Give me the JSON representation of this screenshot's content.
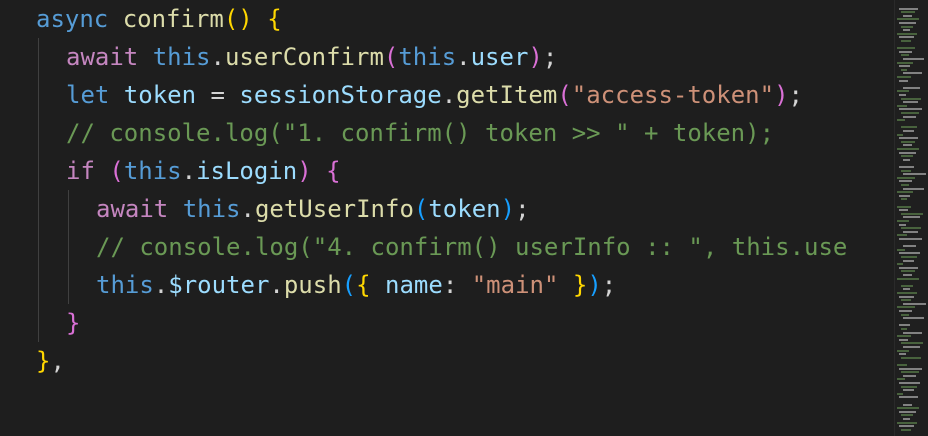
{
  "colors": {
    "background": "#1e1e1e",
    "keyword_blue": "#569cd6",
    "control_purple": "#c586c0",
    "function_yellow": "#dcdcaa",
    "variable_blue": "#9cdcfe",
    "string_orange": "#ce9178",
    "comment_green": "#6a9955",
    "bracket_gold": "#ffd700",
    "bracket_pink": "#da70d6",
    "bracket_blue": "#179fff",
    "punctuation": "#d4d4d4"
  },
  "code_lines": [
    {
      "indent": 0,
      "tokens": [
        {
          "t": "async ",
          "c": "keyword_blue"
        },
        {
          "t": "confirm",
          "c": "function_yellow"
        },
        {
          "t": "()",
          "c": "bracket_gold"
        },
        {
          "t": " ",
          "c": "punctuation"
        },
        {
          "t": "{",
          "c": "bracket_gold"
        }
      ]
    },
    {
      "indent": 1,
      "tokens": [
        {
          "t": "await ",
          "c": "control_purple"
        },
        {
          "t": "this",
          "c": "keyword_blue"
        },
        {
          "t": ".",
          "c": "punctuation"
        },
        {
          "t": "userConfirm",
          "c": "function_yellow"
        },
        {
          "t": "(",
          "c": "bracket_pink"
        },
        {
          "t": "this",
          "c": "keyword_blue"
        },
        {
          "t": ".",
          "c": "punctuation"
        },
        {
          "t": "user",
          "c": "variable_blue"
        },
        {
          "t": ")",
          "c": "bracket_pink"
        },
        {
          "t": ";",
          "c": "punctuation"
        }
      ]
    },
    {
      "indent": 1,
      "tokens": [
        {
          "t": "let ",
          "c": "keyword_blue"
        },
        {
          "t": "token",
          "c": "variable_blue"
        },
        {
          "t": " = ",
          "c": "punctuation"
        },
        {
          "t": "sessionStorage",
          "c": "variable_blue"
        },
        {
          "t": ".",
          "c": "punctuation"
        },
        {
          "t": "getItem",
          "c": "function_yellow"
        },
        {
          "t": "(",
          "c": "bracket_pink"
        },
        {
          "t": "\"access-token\"",
          "c": "string_orange"
        },
        {
          "t": ")",
          "c": "bracket_pink"
        },
        {
          "t": ";",
          "c": "punctuation"
        }
      ]
    },
    {
      "indent": 1,
      "tokens": [
        {
          "t": "// console.log(\"1. confirm() token >> \" + token);",
          "c": "comment_green"
        }
      ]
    },
    {
      "indent": 1,
      "tokens": [
        {
          "t": "if ",
          "c": "control_purple"
        },
        {
          "t": "(",
          "c": "bracket_pink"
        },
        {
          "t": "this",
          "c": "keyword_blue"
        },
        {
          "t": ".",
          "c": "punctuation"
        },
        {
          "t": "isLogin",
          "c": "variable_blue"
        },
        {
          "t": ")",
          "c": "bracket_pink"
        },
        {
          "t": " ",
          "c": "punctuation"
        },
        {
          "t": "{",
          "c": "bracket_pink"
        }
      ]
    },
    {
      "indent": 2,
      "tokens": [
        {
          "t": "await ",
          "c": "control_purple"
        },
        {
          "t": "this",
          "c": "keyword_blue"
        },
        {
          "t": ".",
          "c": "punctuation"
        },
        {
          "t": "getUserInfo",
          "c": "function_yellow"
        },
        {
          "t": "(",
          "c": "bracket_blue"
        },
        {
          "t": "token",
          "c": "variable_blue"
        },
        {
          "t": ")",
          "c": "bracket_blue"
        },
        {
          "t": ";",
          "c": "punctuation"
        }
      ]
    },
    {
      "indent": 2,
      "tokens": [
        {
          "t": "// console.log(\"4. confirm() userInfo :: \", this.use",
          "c": "comment_green"
        }
      ]
    },
    {
      "indent": 2,
      "tokens": [
        {
          "t": "this",
          "c": "keyword_blue"
        },
        {
          "t": ".",
          "c": "punctuation"
        },
        {
          "t": "$router",
          "c": "variable_blue"
        },
        {
          "t": ".",
          "c": "punctuation"
        },
        {
          "t": "push",
          "c": "function_yellow"
        },
        {
          "t": "(",
          "c": "bracket_blue"
        },
        {
          "t": "{",
          "c": "bracket_gold"
        },
        {
          "t": " ",
          "c": "punctuation"
        },
        {
          "t": "name",
          "c": "variable_blue"
        },
        {
          "t": ": ",
          "c": "punctuation"
        },
        {
          "t": "\"main\"",
          "c": "string_orange"
        },
        {
          "t": " ",
          "c": "punctuation"
        },
        {
          "t": "}",
          "c": "bracket_gold"
        },
        {
          "t": ")",
          "c": "bracket_blue"
        },
        {
          "t": ";",
          "c": "punctuation"
        }
      ]
    },
    {
      "indent": 1,
      "tokens": [
        {
          "t": "}",
          "c": "bracket_pink"
        }
      ]
    },
    {
      "indent": 0,
      "tokens": [
        {
          "t": "}",
          "c": "bracket_gold"
        },
        {
          "t": ",",
          "c": "punctuation"
        }
      ]
    }
  ]
}
